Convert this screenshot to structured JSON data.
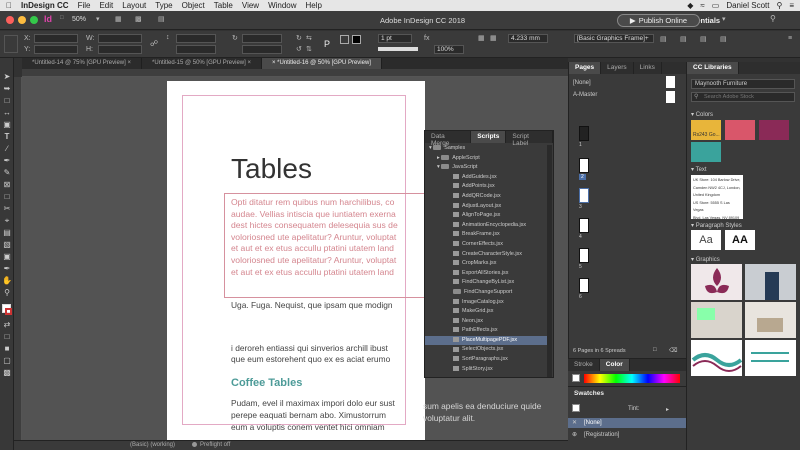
{
  "menubar": {
    "app_name": "InDesign CC",
    "items": [
      "File",
      "Edit",
      "Layout",
      "Type",
      "Object",
      "Table",
      "View",
      "Window",
      "Help"
    ],
    "user": "Daniel Scott"
  },
  "titlebar": {
    "title": "Adobe InDesign CC 2018",
    "zoom": "50%",
    "publish_label": "Publish Online",
    "workspace": "Essentials"
  },
  "control": {
    "x_label": "X:",
    "y_label": "Y:",
    "w_label": "W:",
    "h_label": "H:",
    "stroke_weight": "1 pt",
    "opacity": "100%",
    "dimension": "4.233 mm",
    "frame_style": "[Basic Graphics Frame]+"
  },
  "doc_tabs": [
    {
      "label": "*Untitled-14 @ 75% [GPU Preview]",
      "active": false
    },
    {
      "label": "*Untitled-15 @ 50% [GPU Preview]",
      "active": false
    },
    {
      "label": "*Untitled-16 @ 50% [GPU Preview]",
      "active": true
    }
  ],
  "page": {
    "title": "Tables",
    "lorem_lines": [
      "Opti ditatur rem quibus num harchilibus, co",
      "audae. Vellias intiscia que iuntiatem exerna",
      "dest hictes consequatem delesequia sus de",
      "voloriosned ute apelitatur? Aruntur, voluptat",
      "et aut et ex etus accullu ptatini utatem land",
      "voloriosned ute apelitatur? Aruntur, voluptat",
      "et aut et ex etus accullu ptatini utatem land"
    ],
    "para1": "Uga. Fuga. Nequist, que ipsam que modign",
    "para2_line1": "i deroreh entiassi qui sinverios archill ibust",
    "para2_line2": "que eum estorehent quo ex es aciat erumo",
    "subheading": "Coffee Tables",
    "para3_line1": "Pudam, evel il maximax impori dolo eur sust",
    "para3_line2": "perepe eaquati bernam abo. Ximustorrum",
    "para3_line3": "eum a voluptis conem ventet hici omniam",
    "overflow_line1": "sum apelis ea denduciure quide",
    "overflow_line2": "voluptatur alit."
  },
  "scripts_panel": {
    "tabs": [
      {
        "label": "Data Merge",
        "active": false
      },
      {
        "label": "Scripts",
        "active": true
      },
      {
        "label": "Script Label",
        "active": false
      }
    ],
    "folders": [
      "Samples",
      "AppleScript",
      "JavaScript"
    ],
    "items": [
      "AddGuides.jsx",
      "AddPoints.jsx",
      "AddQRCode.jsx",
      "AdjustLayout.jsx",
      "AlignToPage.jsx",
      "AnimationEncyclopedia.jsx",
      "BreakFrame.jsx",
      "CornerEffects.jsx",
      "CreateCharacterStyle.jsx",
      "CropMarks.jsx",
      "ExportAllStories.jsx",
      "FindChangeByList.jsx",
      "FindChangeSupport",
      "ImageCatalog.jsx",
      "MakeGrid.jsx",
      "Neon.jsx",
      "PathEffects.jsx",
      "PlaceMultipagePDF.jsx",
      "SelectObjects.jsx",
      "SortParagraphs.jsx",
      "SplitStory.jsx"
    ],
    "selected_index": 17
  },
  "pages_panel": {
    "tabs": [
      "Pages",
      "Layers",
      "Links"
    ],
    "none_label": "[None]",
    "master_label": "A-Master",
    "page_numbers": [
      "1",
      "2",
      "3",
      "4",
      "5",
      "6"
    ],
    "summary": "6 Pages in 6 Spreads"
  },
  "stroke_panel": {
    "tabs": [
      "Stroke",
      "Color"
    ]
  },
  "swatches_panel": {
    "title": "Swatches",
    "tint_label": "Tint:",
    "rows": [
      "[None]",
      "[Registration]"
    ]
  },
  "cc_libraries": {
    "title": "CC Libraries",
    "library": "Maynooth Furniture",
    "search_placeholder": "Search Adobe Stock",
    "colors_label": "Colors",
    "color_swatches": [
      "#e8b53a",
      "#d9566a",
      "#8a2a57",
      "#3aa39c"
    ],
    "swatch_text": "Rs243 Go...",
    "text_label": "Text",
    "address_lines": [
      "UK Store: 104 Barlow Drive,",
      "Camden NW2 4CJ, London,",
      "United Kingdom",
      "US Store: 5555 S Las Vegas",
      "Blvd, Las Vegas, NV 89109"
    ],
    "para_styles_label": "Paragraph Styles",
    "style_sample_1": "Aa",
    "style_sample_2": "AA",
    "graphics_label": "Graphics"
  },
  "status": {
    "zoom": "(Basic) (working)",
    "preflight": "Preflight off"
  }
}
